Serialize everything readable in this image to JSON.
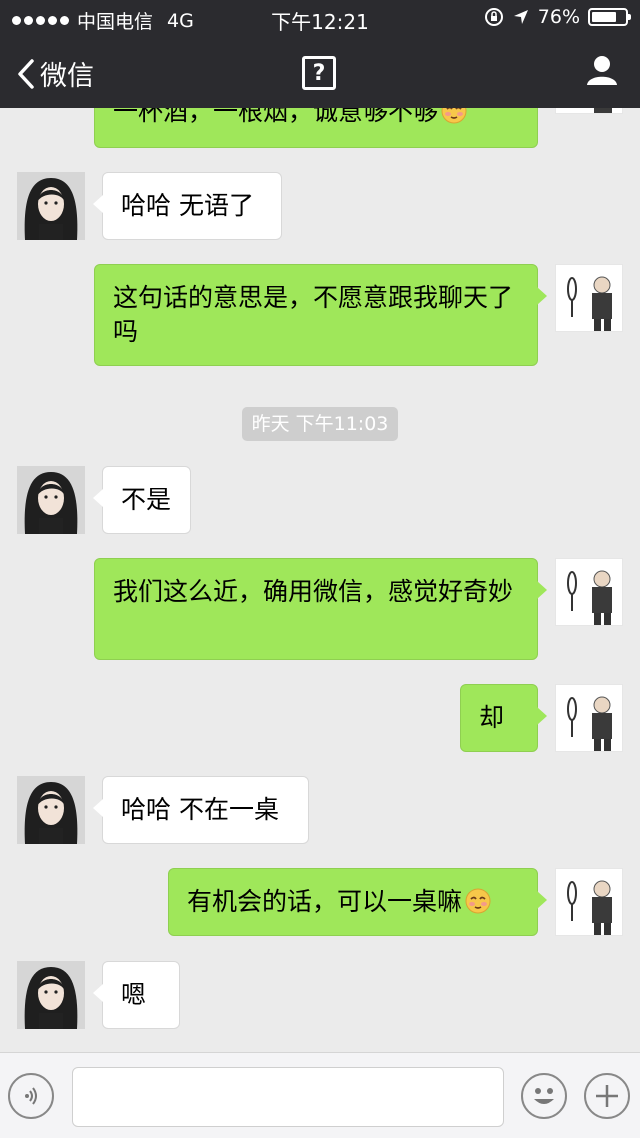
{
  "status_bar": {
    "carrier": "中国电信",
    "network": "4G",
    "time": "下午12:21",
    "battery": "76%",
    "battery_level": 0.76
  },
  "nav": {
    "back_label": "微信",
    "help_icon": "question-icon",
    "profile_icon": "person-icon"
  },
  "messages": [
    {
      "side": "out",
      "text": "一杯酒，一根烟，诚意够不够",
      "emoji": "blush-emoji"
    },
    {
      "side": "in",
      "text": "哈哈 无语了"
    },
    {
      "side": "out",
      "text": "这句话的意思是，不愿意跟我聊天了吗"
    },
    {
      "side": "in",
      "text": "不是"
    },
    {
      "side": "out",
      "text": "我们这么近，确用微信，感觉好奇妙"
    },
    {
      "side": "out",
      "text": "却"
    },
    {
      "side": "in",
      "text": "哈哈 不在一桌"
    },
    {
      "side": "out",
      "text": "有机会的话，可以一桌嘛",
      "emoji": "blush-emoji"
    },
    {
      "side": "in",
      "text": "嗯"
    }
  ],
  "timestamp": "昨天 下午11:03",
  "input_bar": {
    "voice_icon": "voice-icon",
    "text_value": "",
    "emoji_icon": "smiley-icon",
    "plus_icon": "plus-icon"
  },
  "colors": {
    "header_bg": "#2b2b2f",
    "chat_bg": "#ebebeb",
    "outgoing_bubble": "#9fe75a",
    "incoming_bubble": "#ffffff"
  }
}
